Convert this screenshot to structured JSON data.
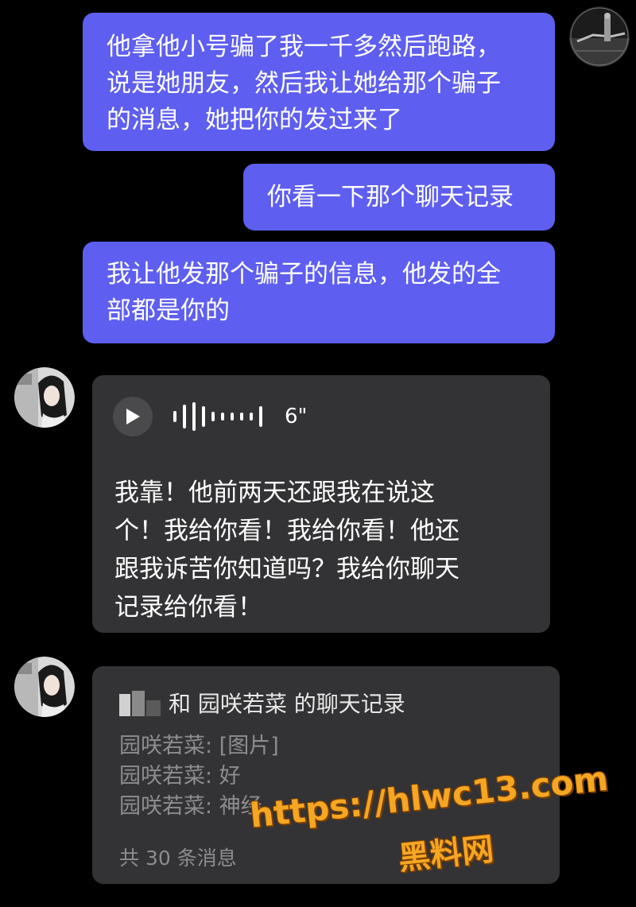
{
  "messages": {
    "out_1": "他拿他小号骗了我一千多然后跑路，\n说是她朋友，然后我让她给那个骗子\n的消息，她把你的发过来了",
    "out_2": "你看一下那个聊天记录",
    "out_3": "我让他发那个骗子的信息，他发的全\n部都是你的"
  },
  "voice": {
    "icon": "play-icon",
    "duration": "6\"",
    "text": "我靠！他前两天还跟我在说这\n个！我给你看！我给你看！他还\n跟我诉苦你知道吗？我给你聊天\n记录给你看！"
  },
  "chat_record": {
    "title": "和 园咲若菜 的聊天记录",
    "lines": [
      "园咲若菜: [图片]",
      "园咲若菜: 好",
      "园咲若菜: 神经"
    ],
    "count": "共 30 条消息"
  },
  "watermark": {
    "url": "https://hlwc13.com",
    "site": "黑料网"
  },
  "colors": {
    "background": "#000000",
    "outgoing_bubble": "#5e5ef0",
    "incoming_bubble": "#333335",
    "watermark": "#f5a623"
  }
}
